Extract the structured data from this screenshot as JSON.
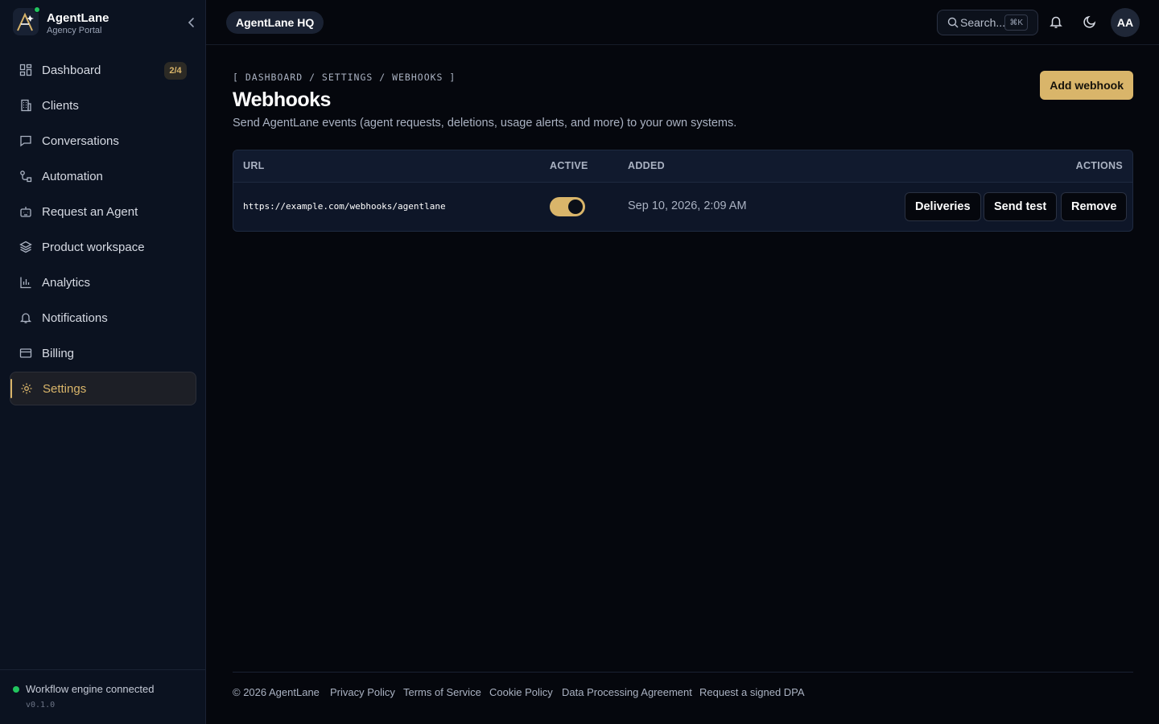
{
  "sidebar": {
    "brand_name": "AgentLane",
    "brand_sub": "Agency Portal",
    "items": [
      {
        "label": "Dashboard",
        "badge": "2/4"
      },
      {
        "label": "Clients"
      },
      {
        "label": "Conversations"
      },
      {
        "label": "Automation"
      },
      {
        "label": "Request an Agent"
      },
      {
        "label": "Product workspace"
      },
      {
        "label": "Analytics"
      },
      {
        "label": "Notifications"
      },
      {
        "label": "Billing"
      },
      {
        "label": "Settings"
      }
    ],
    "status_text": "Workflow engine connected",
    "version": "v0.1.0"
  },
  "topbar": {
    "workspace": "AgentLane HQ",
    "search_placeholder": "Search...",
    "search_shortcut": "⌘K",
    "avatar_initials": "AA"
  },
  "page": {
    "breadcrumb": "[ DASHBOARD / SETTINGS / WEBHOOKS ]",
    "title": "Webhooks",
    "description": "Send AgentLane events (agent requests, deletions, usage alerts, and more) to your own systems.",
    "add_button": "Add webhook"
  },
  "table": {
    "headers": {
      "url": "URL",
      "active": "ACTIVE",
      "added": "ADDED",
      "actions": "ACTIONS"
    },
    "rows": [
      {
        "url": "https://example.com/webhooks/agentlane",
        "active": true,
        "added": "Sep 10, 2026, 2:09 AM",
        "actions": [
          "Deliveries",
          "Send test",
          "Remove"
        ]
      }
    ]
  },
  "footer": {
    "copyright": "© 2026 AgentLane",
    "links": [
      "Privacy Policy",
      "Terms of Service",
      "Cookie Policy",
      "Data Processing Agreement",
      "Request a signed DPA"
    ]
  },
  "colors": {
    "accent": "#d9b56a",
    "background": "#05070d",
    "sidebar": "#0b1220",
    "status_ok": "#22c55e"
  }
}
